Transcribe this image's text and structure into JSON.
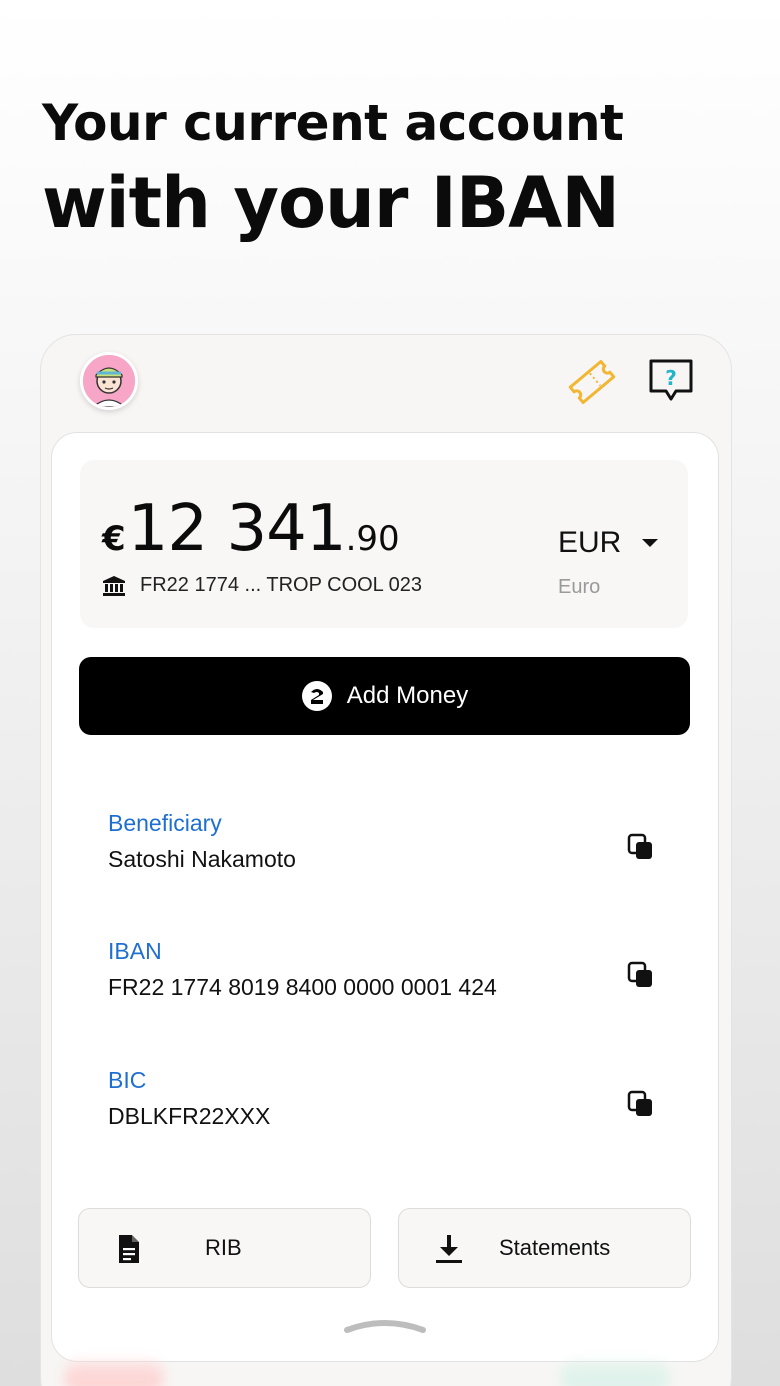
{
  "headline": {
    "line1": "Your current account",
    "line2": "with your IBAN"
  },
  "topbar": {
    "avatar_icon": "user-avatar",
    "ticket_icon": "ticket-icon",
    "help_icon": "help-chat-icon",
    "accent_color": "#f2b632"
  },
  "balance": {
    "currency_symbol": "€",
    "integer_part": "12 341",
    "decimal_part": ".90",
    "iban_short": "FR22 1774 ... TROP COOL 023",
    "currency_code": "EUR",
    "currency_name": "Euro"
  },
  "actions": {
    "add_money_label": "Add Money"
  },
  "details": [
    {
      "label": "Beneficiary",
      "value": "Satoshi Nakamoto"
    },
    {
      "label": "IBAN",
      "value": "FR22 1774 8019 8400 0000 0001 424"
    },
    {
      "label": "BIC",
      "value": "DBLKFR22XXX"
    }
  ],
  "buttons": {
    "rib_label": "RIB",
    "statements_label": "Statements"
  },
  "colors": {
    "label_blue": "#1f6fd1",
    "primary_black": "#000000"
  }
}
